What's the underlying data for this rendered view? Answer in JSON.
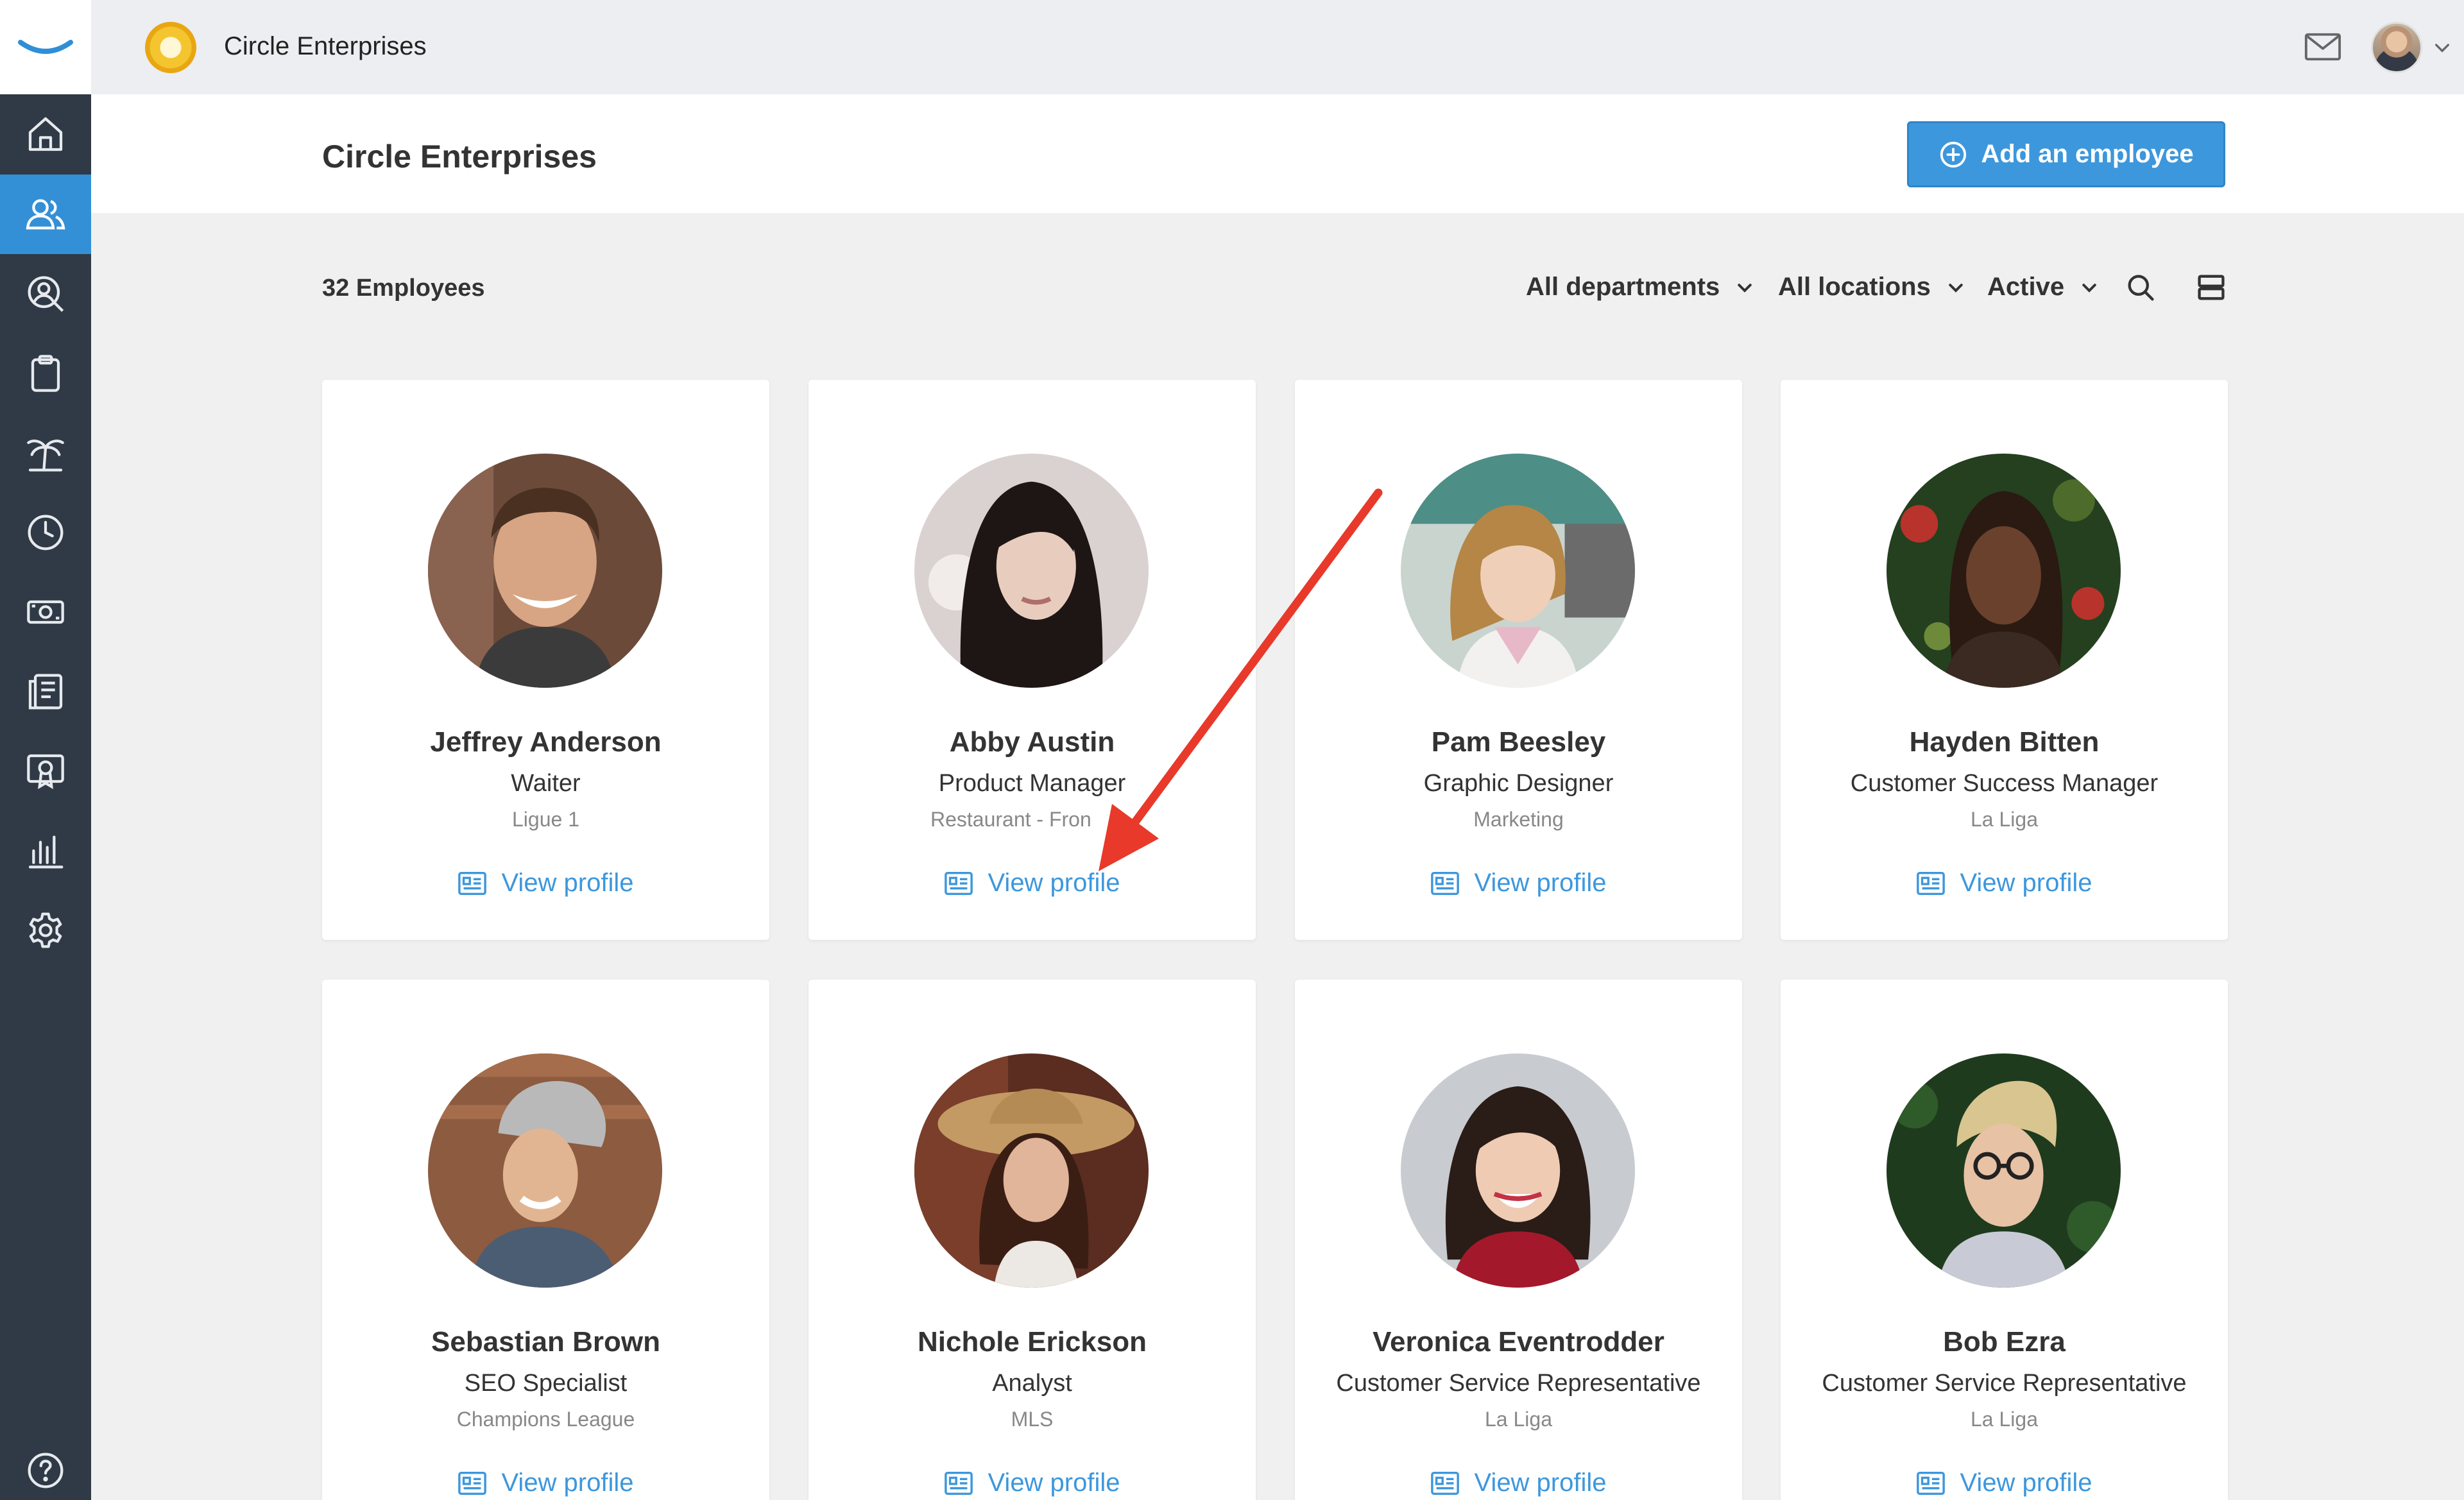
{
  "app": {
    "company_name": "Circle Enterprises"
  },
  "sidebar": {
    "items": [
      {
        "icon": "home-icon",
        "active": false
      },
      {
        "icon": "people-icon",
        "active": true
      },
      {
        "icon": "user-search-icon",
        "active": false
      },
      {
        "icon": "clipboard-icon",
        "active": false
      },
      {
        "icon": "palm-tree-icon",
        "active": false
      },
      {
        "icon": "clock-icon",
        "active": false
      },
      {
        "icon": "money-icon",
        "active": false
      },
      {
        "icon": "documents-icon",
        "active": false
      },
      {
        "icon": "certificate-icon",
        "active": false
      },
      {
        "icon": "bar-chart-icon",
        "active": false
      },
      {
        "icon": "settings-icon",
        "active": false
      },
      {
        "icon": "help-icon",
        "active": false
      }
    ]
  },
  "header": {
    "title": "Circle Enterprises",
    "add_button_label": "Add an employee"
  },
  "toolbar": {
    "employee_count": "32 Employees",
    "filters": {
      "departments": "All departments",
      "locations": "All locations",
      "status": "Active"
    }
  },
  "employees": [
    {
      "name": "Jeffrey Anderson",
      "title": "Waiter",
      "department": "Ligue 1",
      "link": "View profile"
    },
    {
      "name": "Abby Austin",
      "title": "Product Manager",
      "department": "Restaurant - Fron",
      "link": "View profile"
    },
    {
      "name": "Pam Beesley",
      "title": "Graphic Designer",
      "department": "Marketing",
      "link": "View profile"
    },
    {
      "name": "Hayden Bitten",
      "title": "Customer Success Manager",
      "department": "La Liga",
      "link": "View profile"
    },
    {
      "name": "Sebastian Brown",
      "title": "SEO Specialist",
      "department": "Champions League",
      "link": "View profile"
    },
    {
      "name": "Nichole Erickson",
      "title": "Analyst",
      "department": "MLS",
      "link": "View profile"
    },
    {
      "name": "Veronica Eventrodder",
      "title": "Customer Service Representative",
      "department": "La Liga",
      "link": "View profile"
    },
    {
      "name": "Bob Ezra",
      "title": "Customer Service Representative",
      "department": "La Liga",
      "link": "View profile"
    }
  ],
  "colors": {
    "accent": "#3d97dc",
    "sidebar": "#2f3a46",
    "annotation_arrow": "#e8392a"
  }
}
